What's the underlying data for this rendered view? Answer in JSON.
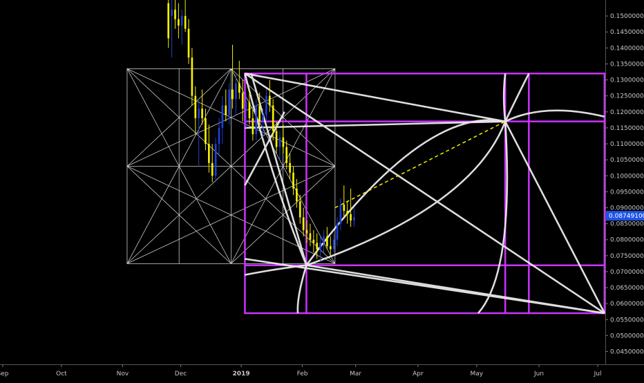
{
  "chart_data": {
    "type": "candlestick",
    "title": "",
    "xlabel": "",
    "ylabel": "",
    "ylim": [
      0.041,
      0.155
    ],
    "x_ticks": [
      "Sep",
      "Oct",
      "Nov",
      "Dec",
      "2019",
      "Feb",
      "Mar",
      "Apr",
      "May",
      "Jun",
      "Jul"
    ],
    "y_ticks": [
      "0.15000000",
      "0.14500000",
      "0.14000000",
      "0.13500000",
      "0.13000000",
      "0.12500000",
      "0.12000000",
      "0.11500000",
      "0.11000000",
      "0.10500000",
      "0.10000000",
      "0.09500000",
      "0.09000000",
      "0.08500000",
      "0.08000000",
      "0.07500000",
      "0.07000000",
      "0.06500000",
      "0.06000000",
      "0.05500000",
      "0.05000000",
      "0.04500000"
    ],
    "y_tick_values": [
      0.15,
      0.145,
      0.14,
      0.135,
      0.13,
      0.125,
      0.12,
      0.115,
      0.11,
      0.105,
      0.1,
      0.095,
      0.09,
      0.085,
      0.08,
      0.075,
      0.07,
      0.065,
      0.06,
      0.055,
      0.05,
      0.045
    ],
    "current_price": "0.08749100",
    "current_price_value": 0.087491,
    "grid": false,
    "colors": {
      "background": "#000000",
      "up_candle": "#1f3fd8",
      "down_candle": "#f4f000",
      "overlay_white": "#f0f0f0",
      "overlay_magenta": "#cc33ff",
      "projection": "#f4f000",
      "price_tag": "#1e53e5",
      "axis_text": "#c8c8c8"
    },
    "candles": [
      [
        0.154,
        0.156,
        0.14,
        0.143
      ],
      [
        0.15,
        0.155,
        0.137,
        0.152
      ],
      [
        0.152,
        0.156,
        0.146,
        0.149
      ],
      [
        0.149,
        0.154,
        0.143,
        0.147
      ],
      [
        0.147,
        0.152,
        0.141,
        0.15
      ],
      [
        0.15,
        0.157,
        0.145,
        0.146
      ],
      [
        0.146,
        0.149,
        0.135,
        0.137
      ],
      [
        0.137,
        0.14,
        0.122,
        0.125
      ],
      [
        0.125,
        0.128,
        0.113,
        0.118
      ],
      [
        0.118,
        0.124,
        0.103,
        0.121
      ],
      [
        0.121,
        0.127,
        0.116,
        0.118
      ],
      [
        0.118,
        0.121,
        0.108,
        0.11
      ],
      [
        0.11,
        0.116,
        0.101,
        0.104
      ],
      [
        0.104,
        0.11,
        0.098,
        0.1
      ],
      [
        0.1,
        0.112,
        0.098,
        0.11
      ],
      [
        0.11,
        0.118,
        0.106,
        0.115
      ],
      [
        0.115,
        0.125,
        0.11,
        0.122
      ],
      [
        0.122,
        0.127,
        0.117,
        0.119
      ],
      [
        0.119,
        0.129,
        0.116,
        0.127
      ],
      [
        0.127,
        0.141,
        0.121,
        0.124
      ],
      [
        0.124,
        0.132,
        0.119,
        0.129
      ],
      [
        0.129,
        0.136,
        0.124,
        0.126
      ],
      [
        0.126,
        0.13,
        0.117,
        0.121
      ],
      [
        0.121,
        0.126,
        0.115,
        0.123
      ],
      [
        0.123,
        0.127,
        0.116,
        0.118
      ],
      [
        0.118,
        0.121,
        0.111,
        0.113
      ],
      [
        0.113,
        0.124,
        0.111,
        0.122
      ],
      [
        0.122,
        0.126,
        0.115,
        0.117
      ],
      [
        0.117,
        0.121,
        0.112,
        0.119
      ],
      [
        0.119,
        0.127,
        0.117,
        0.125
      ],
      [
        0.125,
        0.13,
        0.12,
        0.122
      ],
      [
        0.122,
        0.124,
        0.111,
        0.114
      ],
      [
        0.114,
        0.117,
        0.107,
        0.109
      ],
      [
        0.109,
        0.114,
        0.105,
        0.112
      ],
      [
        0.112,
        0.116,
        0.107,
        0.109
      ],
      [
        0.109,
        0.111,
        0.102,
        0.104
      ],
      [
        0.104,
        0.107,
        0.099,
        0.101
      ],
      [
        0.101,
        0.103,
        0.094,
        0.096
      ],
      [
        0.096,
        0.099,
        0.09,
        0.092
      ],
      [
        0.092,
        0.094,
        0.085,
        0.087
      ],
      [
        0.087,
        0.09,
        0.081,
        0.083
      ],
      [
        0.083,
        0.086,
        0.079,
        0.082
      ],
      [
        0.082,
        0.085,
        0.078,
        0.08
      ],
      [
        0.08,
        0.083,
        0.076,
        0.079
      ],
      [
        0.079,
        0.082,
        0.074,
        0.077
      ],
      [
        0.077,
        0.081,
        0.073,
        0.079
      ],
      [
        0.079,
        0.083,
        0.076,
        0.081
      ],
      [
        0.081,
        0.084,
        0.077,
        0.078
      ],
      [
        0.078,
        0.081,
        0.075,
        0.077
      ],
      [
        0.077,
        0.082,
        0.076,
        0.08
      ],
      [
        0.08,
        0.087,
        0.078,
        0.085
      ],
      [
        0.085,
        0.093,
        0.083,
        0.091
      ],
      [
        0.091,
        0.097,
        0.087,
        0.089
      ],
      [
        0.089,
        0.092,
        0.085,
        0.088
      ],
      [
        0.088,
        0.096,
        0.084,
        0.086
      ],
      [
        0.086,
        0.09,
        0.084,
        0.087
      ]
    ],
    "overlays": {
      "white_square": {
        "t0": 0.21,
        "t1": 0.5535,
        "top": 0.1335,
        "bottom": 0.0725
      },
      "magenta_square": {
        "t0": 0.4046,
        "t1": 0.9987,
        "top": 0.132,
        "bottom": 0.057
      },
      "magenta_inner_verticals": [
        0.5062,
        0.8347,
        0.8737
      ],
      "magenta_inner_horizontals": [
        0.117,
        0.072
      ],
      "projection_line": {
        "from_t": 0.5535,
        "from_y": 0.09,
        "to_t": 0.8347,
        "to_y": 0.117
      }
    }
  }
}
